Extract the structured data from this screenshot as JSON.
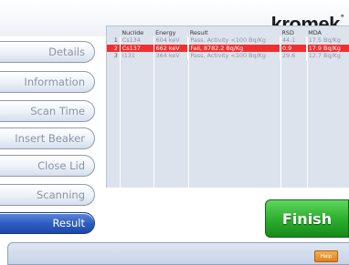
{
  "brand": {
    "logo": "kromek",
    "mark": "°"
  },
  "nav": [
    {
      "label": "Details",
      "active": false
    },
    {
      "label": "Information",
      "active": false
    },
    {
      "label": "Scan Time",
      "active": false
    },
    {
      "label": "Insert Beaker",
      "active": false
    },
    {
      "label": "Close Lid",
      "active": false
    },
    {
      "label": "Scanning",
      "active": false
    },
    {
      "label": "Result",
      "active": true
    }
  ],
  "results": {
    "columns": [
      "Nuclide",
      "Energy",
      "Result",
      "RSD",
      "MDA"
    ],
    "rows": [
      {
        "n": "1",
        "nuclide": "Cs134",
        "energy": "604 keV",
        "result": "Pass, Activity <100 Bq/Kg",
        "rsd": "44.1",
        "mda": "17.5 Bq/Kg",
        "status": "pass"
      },
      {
        "n": "2",
        "nuclide": "Cs137",
        "energy": "662 keV",
        "result": "Fail, 8782.2 Bq/Kg",
        "rsd": "0.9",
        "mda": "17.9 Bq/Kg",
        "status": "fail"
      },
      {
        "n": "3",
        "nuclide": "I131",
        "energy": "364 keV",
        "result": "Pass, Activity <100 Bq/Kg",
        "rsd": "29.6",
        "mda": "12.7 Bq/Kg",
        "status": "pass"
      }
    ]
  },
  "finish_label": "Finish",
  "help_label": "Help",
  "colors": {
    "fail_row": "#f03030",
    "finish": "#2eb030",
    "active_nav": "#2f5fc4"
  }
}
